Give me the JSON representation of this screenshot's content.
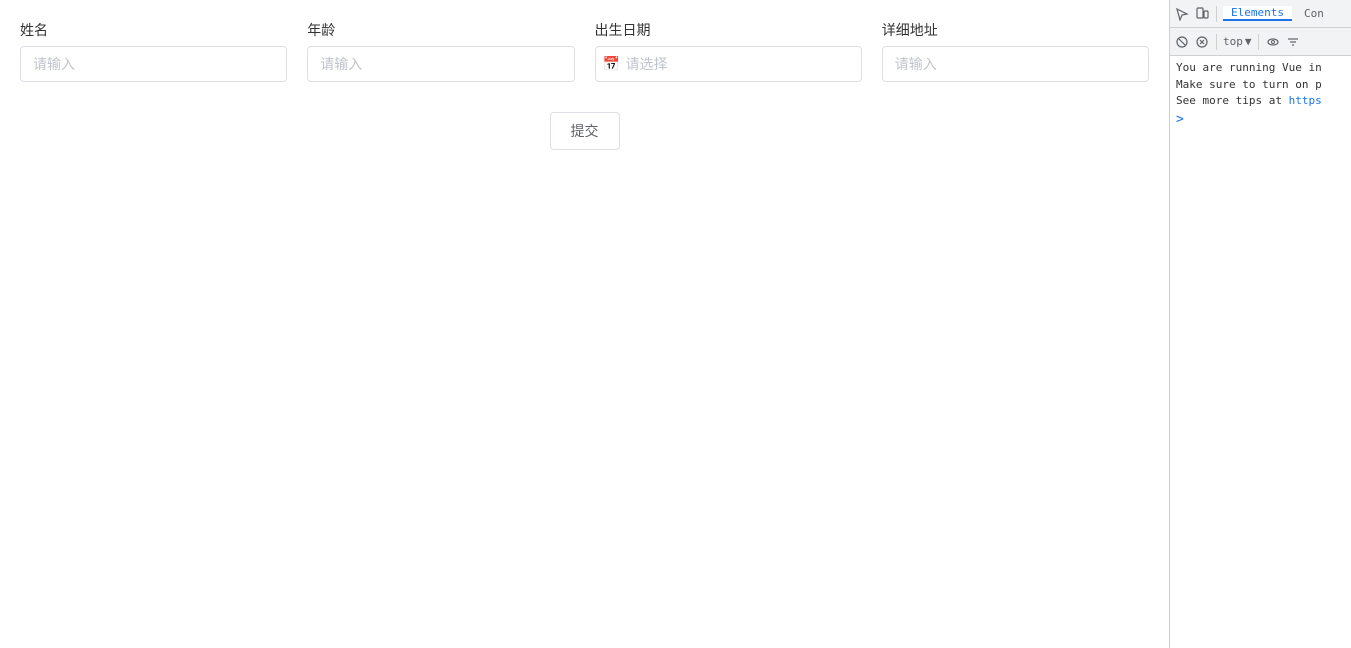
{
  "form": {
    "fields": [
      {
        "label": "姓名",
        "placeholder": "请输入",
        "type": "text",
        "id": "name"
      },
      {
        "label": "年龄",
        "placeholder": "请输入",
        "type": "text",
        "id": "age"
      },
      {
        "label": "出生日期",
        "placeholder": "请选择",
        "type": "date",
        "id": "birthday"
      },
      {
        "label": "详细地址",
        "placeholder": "请输入",
        "type": "text",
        "id": "address"
      }
    ],
    "submit_label": "提交"
  },
  "devtools": {
    "tabs": [
      {
        "label": "Elements",
        "active": true
      },
      {
        "label": "Con",
        "active": false
      }
    ],
    "second_toolbar": {
      "icons": [
        "cursor",
        "device",
        "block",
        "eye"
      ],
      "dropdown_label": "top",
      "extra_icons": [
        "eye2",
        "filter"
      ]
    },
    "console_lines": [
      "You are running Vue in",
      "Make sure to turn on p",
      "See more tips at https"
    ],
    "prompt_symbol": ">"
  }
}
